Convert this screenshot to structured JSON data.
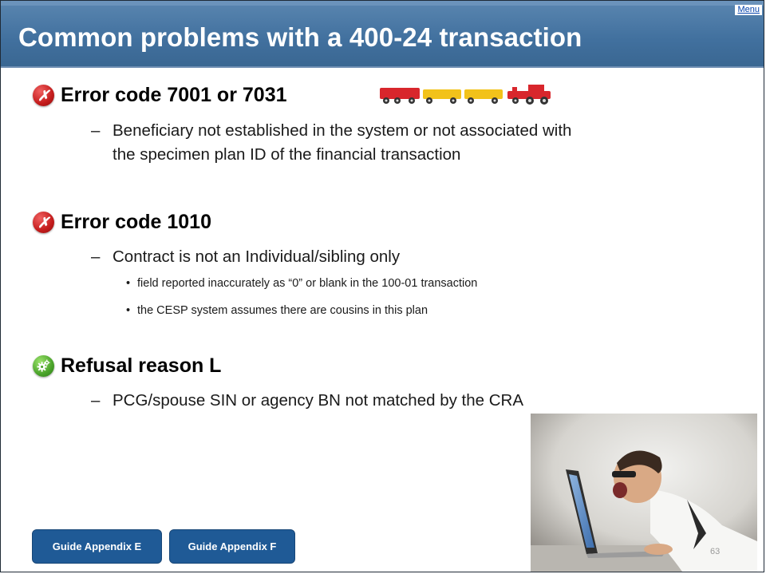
{
  "header": {
    "title": "Common problems with a 400-24 transaction",
    "menu_link": "Menu"
  },
  "sections": [
    {
      "icon": "error-x-icon",
      "heading": "Error code 7001 or 7031",
      "lines": [
        "Beneficiary not established in the system or not associated with",
        "the specimen plan ID of the financial transaction"
      ]
    },
    {
      "icon": "error-x-icon",
      "heading": "Error code 1010",
      "lines": [
        "Contract is not an Individual/sibling only"
      ],
      "bullets": [
        "field reported inaccurately as “0” or blank in the 100-01 transaction",
        "the CESP system assumes there are cousins in this plan"
      ]
    },
    {
      "icon": "gears-icon",
      "heading": "Refusal reason L",
      "lines": [
        "PCG/spouse SIN or agency BN not matched by the CRA"
      ]
    }
  ],
  "buttons": {
    "appendix_e": "Guide Appendix E",
    "appendix_f": "Guide Appendix F"
  },
  "page_number": "63",
  "colors": {
    "title_bar": "#41709e",
    "button": "#1f5a96",
    "error_icon": "#c41c1c",
    "gear_icon": "#4aa32a"
  }
}
